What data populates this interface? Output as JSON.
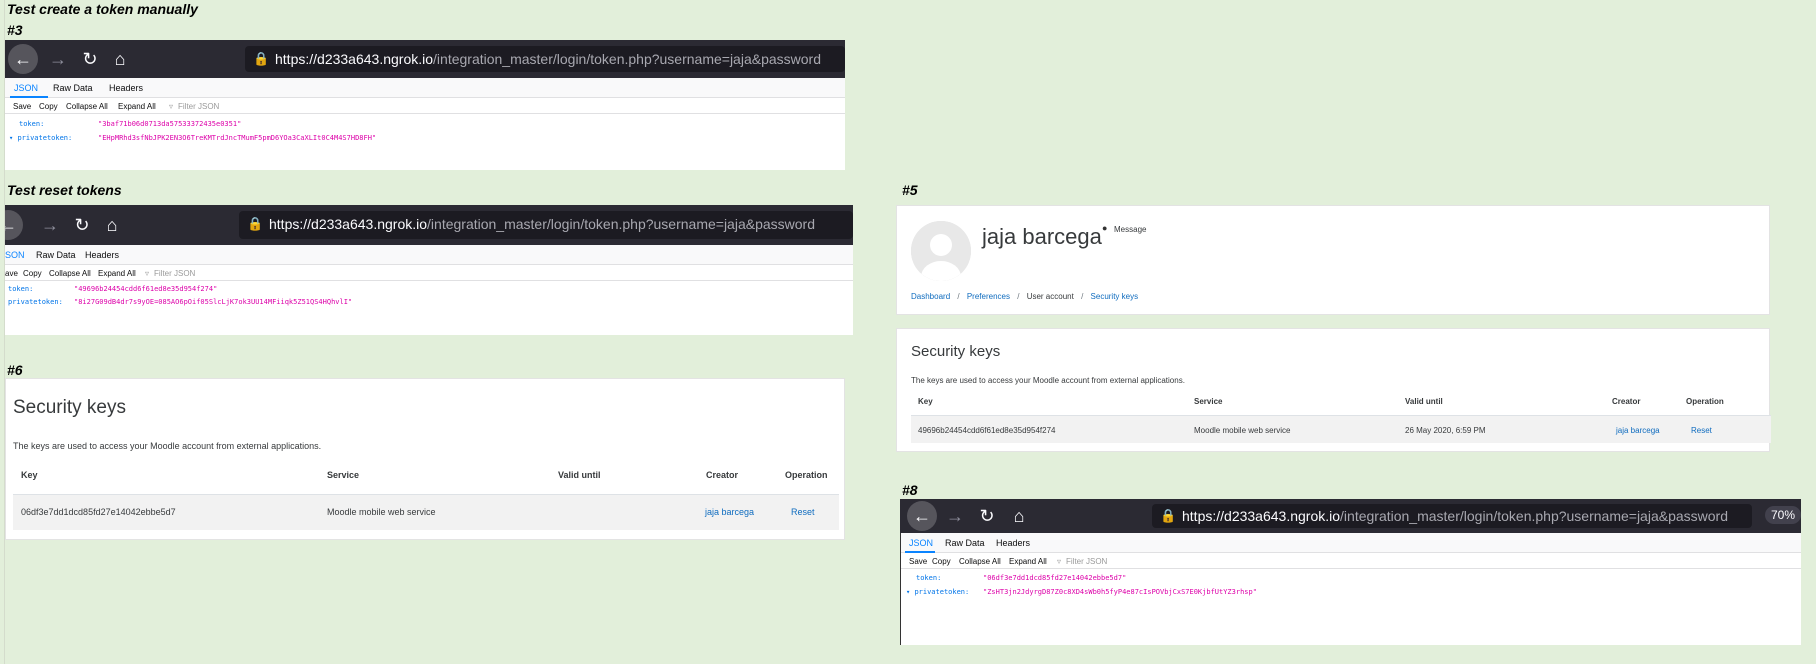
{
  "headings": {
    "create": "Test create a token manually",
    "reset": "Test reset tokens"
  },
  "labels": {
    "s3": "#3",
    "s5": "#5",
    "s6": "#6",
    "s8": "#8"
  },
  "browser": {
    "url_host_prefix": "https://",
    "url_host": "d233a643.ngrok.io",
    "url_path": "/integration_master/login/token.php?username=jaja&password",
    "zoom": "70%"
  },
  "json_viewer": {
    "tabs": [
      "JSON",
      "Raw Data",
      "Headers"
    ],
    "tabs_cut": [
      "SON",
      "Raw Data",
      "Headers"
    ],
    "tools": [
      "Save",
      "Copy",
      "Collapse All",
      "Expand All"
    ],
    "tools_cut": [
      "ave",
      "Copy",
      "Collapse All",
      "Expand All"
    ],
    "filter_placeholder": "Filter JSON",
    "token_key": "token:",
    "privatetoken_key": "privatetoken:"
  },
  "panel3": {
    "token": "\"3baf71b06d0713da57533372435e0351\"",
    "privatetoken": "\"EHpMRhd3sfNbJPK2EN3O6TreKMTrdJncTMumF5pmD6YOa3CaXLIt0C4M4S7HD8FH\""
  },
  "panel_reset": {
    "token": "\"49696b24454cdd6f61ed8e35d954f274\"",
    "privatetoken": "\"8i27G09dB4dr7s9yOE=085AO6pOif05SlcLjK7ok3UU14MFiiqk5Z51QS4HQhvlI\""
  },
  "panel8": {
    "token": "\"06df3e7dd1dcd85fd27e14042ebbe5d7\"",
    "privatetoken": "\"ZsHT3jn2JdyrgD87Z0c8XD4sWb0h5fyP4e87cIsPOVbjCxS7E0KjbfUtYZ3rhsp\""
  },
  "profile": {
    "name": "jaja barcega",
    "message": "Message",
    "breadcrumb": [
      "Dashboard",
      "Preferences",
      "User account",
      "Security keys"
    ]
  },
  "security5": {
    "title": "Security keys",
    "desc": "The keys are used to access your Moodle account from external applications.",
    "columns": [
      "Key",
      "Service",
      "Valid until",
      "Creator",
      "Operation"
    ],
    "row": {
      "key": "49696b24454cdd6f61ed8e35d954f274",
      "service": "Moodle mobile web service",
      "valid": "26 May 2020, 6:59 PM",
      "creator": "jaja barcega",
      "operation": "Reset"
    }
  },
  "security6": {
    "title": "Security keys",
    "desc": "The keys are used to access your Moodle account from external applications.",
    "columns": [
      "Key",
      "Service",
      "Valid until",
      "Creator",
      "Operation"
    ],
    "row": {
      "key": "06df3e7dd1dcd85fd27e14042ebbe5d7",
      "service": "Moodle mobile web service",
      "valid": "",
      "creator": "jaja barcega",
      "operation": "Reset"
    }
  }
}
